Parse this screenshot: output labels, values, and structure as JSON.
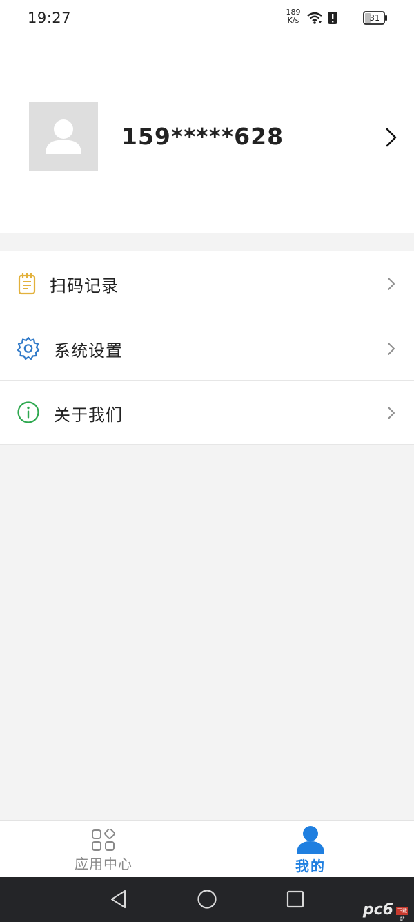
{
  "status_bar": {
    "time": "19:27",
    "net_speed_value": "189",
    "net_speed_unit": "K/s",
    "battery": "31",
    "icons": [
      "wifi-icon",
      "alert-icon",
      "battery-icon"
    ]
  },
  "profile": {
    "avatar_icon": "user-avatar-icon",
    "username": "159*****628",
    "arrow_icon": "chevron-right-icon"
  },
  "menu": {
    "items": [
      {
        "label": "扫码记录",
        "icon": "clipboard-list-icon",
        "icon_color": "#e2b13c"
      },
      {
        "label": "系统设置",
        "icon": "gear-icon",
        "icon_color": "#2f79c8"
      },
      {
        "label": "关于我们",
        "icon": "info-circle-icon",
        "icon_color": "#2ea84f"
      }
    ]
  },
  "tabbar": {
    "tabs": [
      {
        "label": "应用中心",
        "icon": "apps-grid-icon",
        "active": false
      },
      {
        "label": "我的",
        "icon": "person-icon",
        "active": true
      }
    ],
    "active_color": "#1f7fe0",
    "inactive_color": "#8a8a8a"
  },
  "navbar": {
    "icons": [
      "back-icon",
      "home-icon",
      "recent-apps-icon"
    ]
  },
  "watermark": {
    "text": "pc6",
    "sub": "下载站"
  }
}
